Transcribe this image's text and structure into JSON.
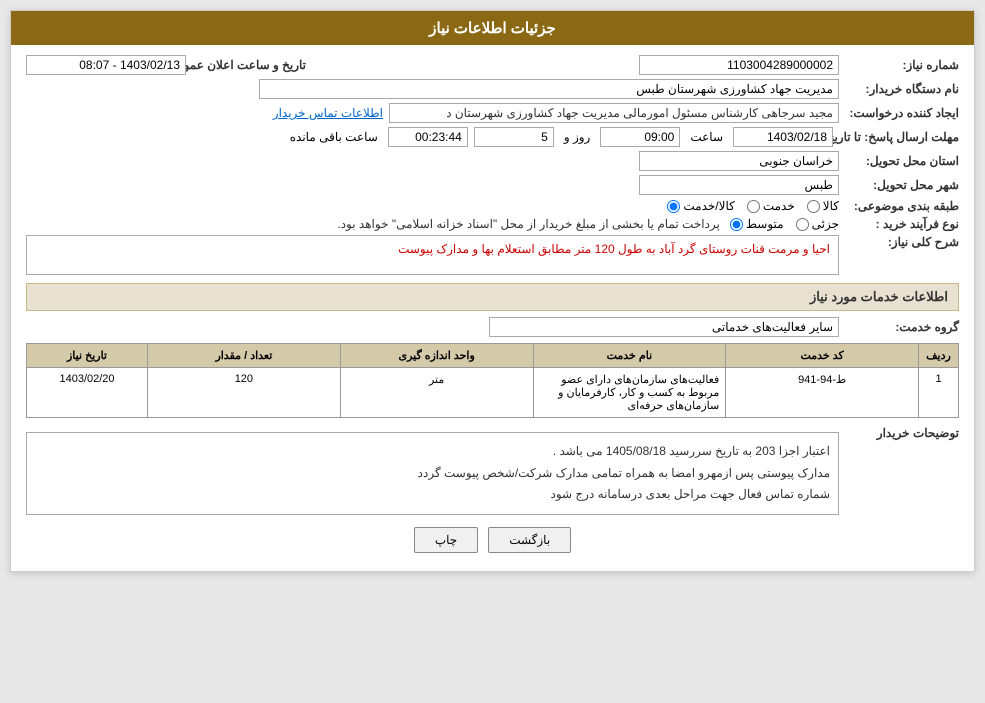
{
  "header": {
    "title": "جزئیات اطلاعات نیاز"
  },
  "fields": {
    "shomareNiaz_label": "شماره نیاز:",
    "shomareNiaz_value": "1103004289000002",
    "namDastgah_label": "نام دستگاه خریدار:",
    "namDastgah_value": "مدیریت جهاد کشاورزی شهرستان طبس",
    "ijadKonande_label": "ایجاد کننده درخواست:",
    "ijadKonande_value": "مجید سرجاهی کارشناس مسئول امورمالی مدیریت جهاد کشاورزی شهرستان د",
    "ijadKonande_link": "اطلاعات تماس خریدار",
    "mohlat_label": "مهلت ارسال پاسخ: تا تاریخ:",
    "tarikh_value": "1403/02/18",
    "saat_label": "ساعت",
    "saat_value": "09:00",
    "roz_label": "روز و",
    "roz_value": "5",
    "saat_mande_label": "ساعت باقی مانده",
    "saat_mande_value": "00:23:44",
    "tarikh_elam_label": "تاریخ و ساعت اعلان عمومی:",
    "tarikh_elam_value": "1403/02/13 - 08:07",
    "ostan_label": "استان محل تحویل:",
    "ostan_value": "خراسان جنوبی",
    "shahr_label": "شهر محل تحویل:",
    "shahr_value": "طبس",
    "tabaqebandi_label": "طبقه بندی موضوعی:",
    "kala": "کالا",
    "khadamat": "خدمت",
    "kala_khadamat": "کالا/خدمت",
    "naveFarayand_label": "نوع فرآیند خرید :",
    "jozei": "جزئی",
    "mottaset": "متوسط",
    "farayand_desc": "پرداخت تمام یا بخشی از مبلغ خریدار از محل \"اسناد خزانه اسلامی\" خواهد بود.",
    "sharh_label": "شرح کلی نیاز:",
    "sharh_value": "احیا و مرمت قنات روستای گرد آباد به طول 120 متر مطابق استعلام بها و مدارک پیوست",
    "info_khadamat_label": "اطلاعات خدمات مورد نیاز",
    "grouh_label": "گروه خدمت:",
    "grouh_value": "سایر فعالیت‌های خدماتی",
    "grid": {
      "headers": [
        "ردیف",
        "کد خدمت",
        "نام خدمت",
        "واحد اندازه گیری",
        "تعداد / مقدار",
        "تاریخ نیاز"
      ],
      "rows": [
        {
          "radif": "1",
          "kod": "ط-94-941",
          "name": "فعالیت‌های سازمان‌های دارای عضو مربوط به کسب و کار، کارفرمایان و سازمان‌های حرفه‌ای",
          "vahed": "متر",
          "tedad": "120",
          "tarikh": "1403/02/20"
        }
      ]
    },
    "tozihat_label": "توضیحات خریدار",
    "tozihat_value": "اعتبار اجزا 203 به تاریخ سررسید 1405/08/18 می باشد .\nمدارک پیوستی پس ازمهرو امضا به همراه تمامی مدارک شرکت/شخص پیوست گردد\nشماره تماس فعال جهت مراحل بعدی درسامانه درج شود"
  },
  "buttons": {
    "print": "چاپ",
    "back": "بازگشت"
  }
}
